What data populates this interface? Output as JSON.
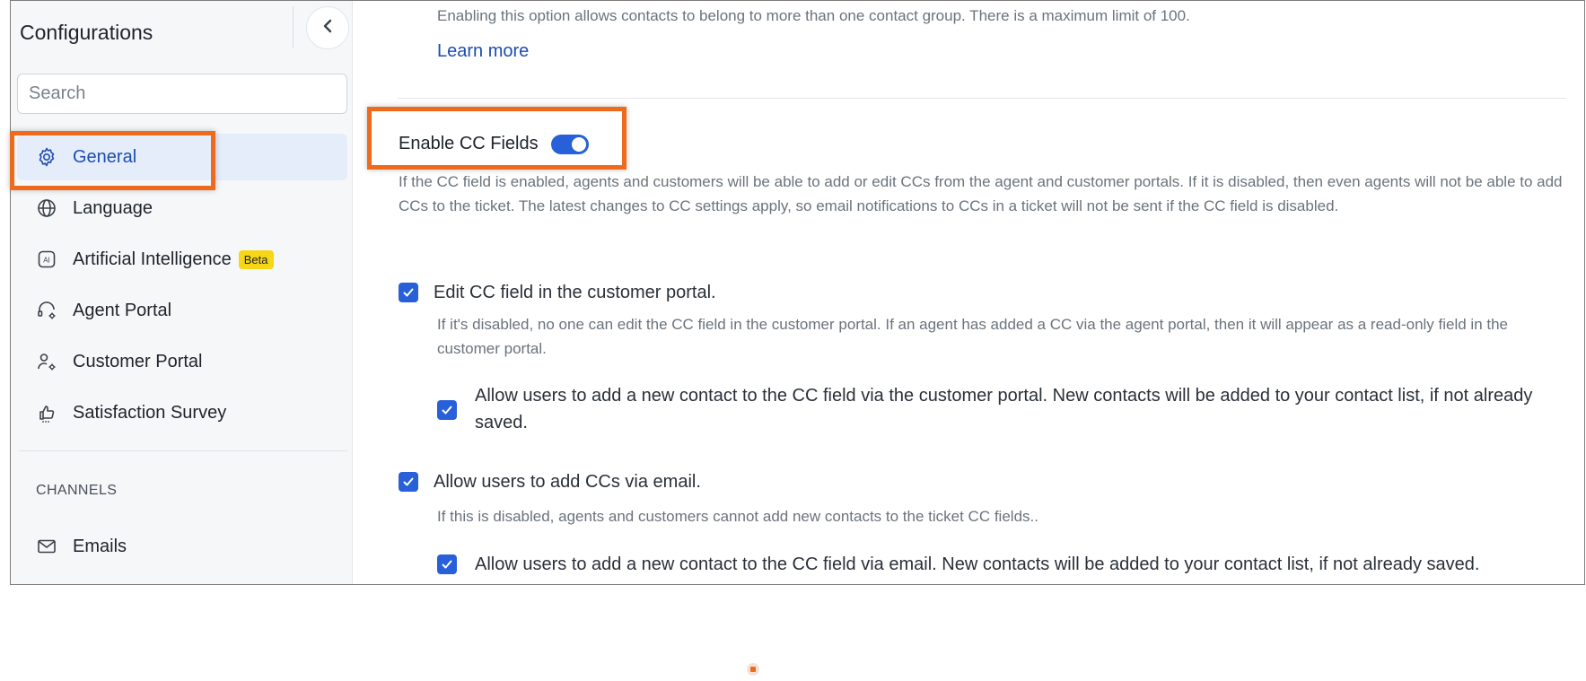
{
  "sidebar": {
    "title": "Configurations",
    "collapse_icon": "chevron-left-icon",
    "search_placeholder": "Search",
    "items": [
      {
        "label": "General",
        "icon": "gear-icon",
        "active": true
      },
      {
        "label": "Language",
        "icon": "globe-icon"
      },
      {
        "label": "Artificial Intelligence",
        "icon": "ai-icon",
        "badge": "Beta"
      },
      {
        "label": "Agent Portal",
        "icon": "headset-gear-icon"
      },
      {
        "label": "Customer Portal",
        "icon": "user-gear-icon"
      },
      {
        "label": "Satisfaction Survey",
        "icon": "thumbs-up-icon"
      }
    ],
    "section_header": "CHANNELS",
    "channels": [
      {
        "label": "Emails",
        "icon": "mail-icon"
      }
    ]
  },
  "main": {
    "top_description": "Enabling this option allows contacts to belong to more than one contact group. There is a maximum limit of 100.",
    "learn_more": "Learn more",
    "cc_toggle_label": "Enable CC Fields",
    "cc_toggle_on": true,
    "cc_description": "If the CC field is enabled, agents and customers will be able to add or edit CCs from the agent and customer portals. If it is disabled, then even agents will not be able to add CCs to the ticket. The latest changes to CC settings apply, so email notifications to CCs in a ticket will not be sent if the CC field is disabled.",
    "options": [
      {
        "label": "Edit CC field in the customer portal.",
        "checked": true,
        "description": "If it's disabled, no one can edit the CC field in the customer portal. If an agent has added a CC via the agent portal, then it will appear as a read-only field in the customer portal.",
        "sub_label": "Allow users to add a new contact to the CC field via the customer portal. New contacts will be added to your contact list, if not already saved.",
        "sub_checked": true
      },
      {
        "label": "Allow users to add CCs via email.",
        "checked": true,
        "description": "If this is disabled, agents and customers cannot add new contacts to the ticket CC fields..",
        "sub_label": "Allow users to add a new contact to the CC field via email. New contacts will be added to your contact list, if not already saved.",
        "sub_checked": true
      }
    ]
  },
  "colors": {
    "accent": "#2760d9",
    "active_bg": "#e6edfa",
    "highlight": "#ee6a1c",
    "beta_badge": "#f6d616"
  }
}
